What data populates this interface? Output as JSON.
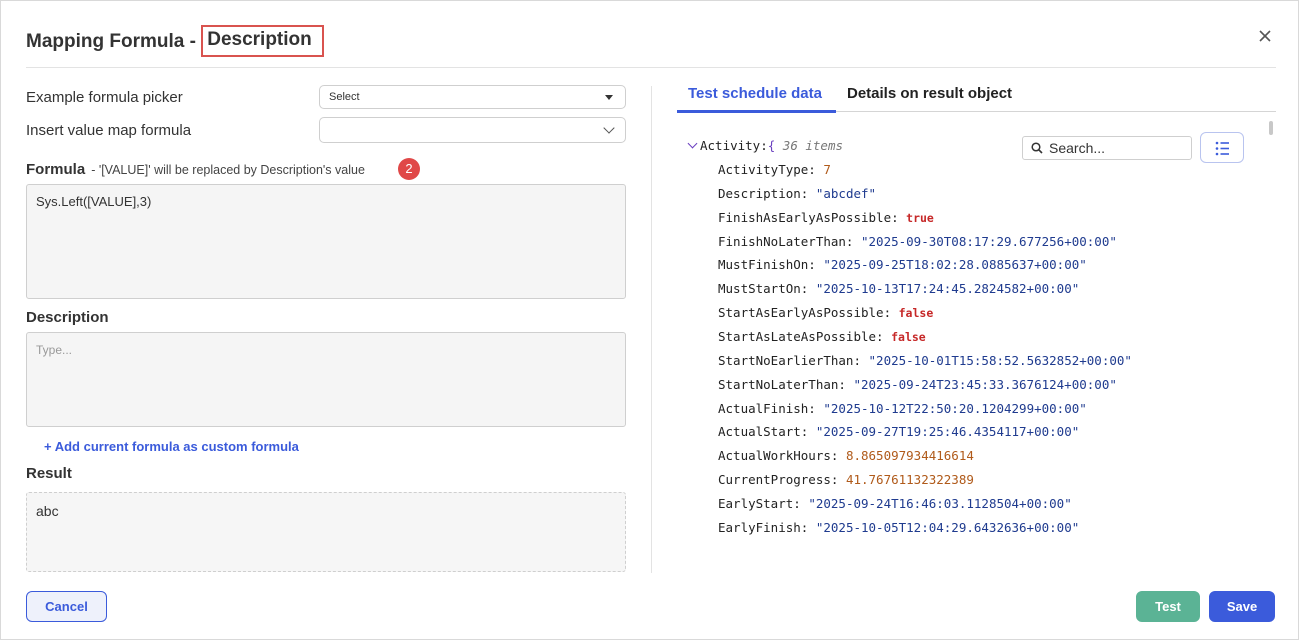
{
  "dialog": {
    "title_prefix": "Mapping Formula - ",
    "title_highlight": "Description"
  },
  "left": {
    "example_picker_label": "Example formula picker",
    "example_picker_value": "Select",
    "insert_map_label": "Insert value map formula",
    "insert_map_value": "",
    "formula_label": "Formula",
    "formula_hint": "- '[VALUE]' will be replaced by Description's value",
    "badge_number": "2",
    "formula_value": "Sys.Left([VALUE],3)",
    "description_label": "Description",
    "description_placeholder": "Type...",
    "add_formula_link": "+ Add current formula as custom formula",
    "result_label": "Result",
    "result_value": "abc"
  },
  "right": {
    "tabs": [
      {
        "label": "Test schedule data",
        "active": true
      },
      {
        "label": "Details on result object",
        "active": false
      }
    ],
    "search_placeholder": "Search...",
    "root": {
      "key": "Activity:",
      "brace": "{",
      "count": "36 items"
    },
    "entries": [
      {
        "key": "ActivityType:",
        "value": "7",
        "type": "num"
      },
      {
        "key": "Description:",
        "value": "\"abcdef\"",
        "type": "str"
      },
      {
        "key": "FinishAsEarlyAsPossible:",
        "value": "true",
        "type": "bool"
      },
      {
        "key": "FinishNoLaterThan:",
        "value": "\"2025-09-30T08:17:29.677256+00:00\"",
        "type": "str"
      },
      {
        "key": "MustFinishOn:",
        "value": "\"2025-09-25T18:02:28.0885637+00:00\"",
        "type": "str"
      },
      {
        "key": "MustStartOn:",
        "value": "\"2025-10-13T17:24:45.2824582+00:00\"",
        "type": "str"
      },
      {
        "key": "StartAsEarlyAsPossible:",
        "value": "false",
        "type": "bool"
      },
      {
        "key": "StartAsLateAsPossible:",
        "value": "false",
        "type": "bool"
      },
      {
        "key": "StartNoEarlierThan:",
        "value": "\"2025-10-01T15:58:52.5632852+00:00\"",
        "type": "str"
      },
      {
        "key": "StartNoLaterThan:",
        "value": "\"2025-09-24T23:45:33.3676124+00:00\"",
        "type": "str"
      },
      {
        "key": "ActualFinish:",
        "value": "\"2025-10-12T22:50:20.1204299+00:00\"",
        "type": "str"
      },
      {
        "key": "ActualStart:",
        "value": "\"2025-09-27T19:25:46.4354117+00:00\"",
        "type": "str"
      },
      {
        "key": "ActualWorkHours:",
        "value": "8.865097934416614",
        "type": "num"
      },
      {
        "key": "CurrentProgress:",
        "value": "41.76761132322389",
        "type": "num"
      },
      {
        "key": "EarlyStart:",
        "value": "\"2025-09-24T16:46:03.1128504+00:00\"",
        "type": "str"
      },
      {
        "key": "EarlyFinish:",
        "value": "\"2025-10-05T12:04:29.6432636+00:00\"",
        "type": "str"
      }
    ]
  },
  "footer": {
    "cancel_label": "Cancel",
    "test_label": "Test",
    "save_label": "Save"
  },
  "colors": {
    "accent": "#3b5bdb",
    "test_button": "#5bb395",
    "highlight_border": "#d9534f",
    "badge": "#e04848"
  }
}
